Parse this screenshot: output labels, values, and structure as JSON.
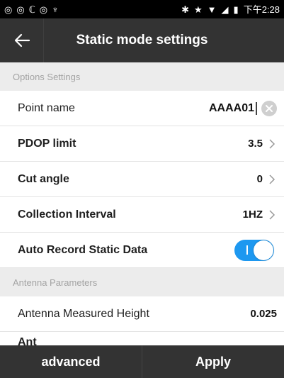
{
  "status_bar": {
    "left_icons": [
      "◎",
      "◎",
      "ℂ",
      "◎",
      "♆"
    ],
    "right_icons": [
      "✱",
      "★",
      "▼",
      "◢"
    ],
    "battery_icon": "▮",
    "time": "下午2:28"
  },
  "app_bar": {
    "title": "Static mode settings",
    "back_icon": "arrow-left-icon"
  },
  "sections": {
    "options": {
      "header": "Options Settings",
      "point_name": {
        "label": "Point name",
        "value": "AAAA01"
      },
      "pdop_limit": {
        "label": "PDOP limit",
        "value": "3.5"
      },
      "cut_angle": {
        "label": "Cut angle",
        "value": "0"
      },
      "collection_interval": {
        "label": "Collection Interval",
        "value": "1HZ"
      },
      "auto_record": {
        "label": "Auto Record Static Data",
        "enabled": true
      }
    },
    "antenna": {
      "header": "Antenna Parameters",
      "measured_height": {
        "label": "Antenna Measured Height",
        "value": "0.025"
      },
      "next_label_partial": "Ant"
    }
  },
  "bottom_bar": {
    "advanced_label": "advanced",
    "apply_label": "Apply"
  },
  "colors": {
    "toolbar": "#333333",
    "section_bg": "#ececec",
    "toggle_on": "#1d98f0"
  }
}
